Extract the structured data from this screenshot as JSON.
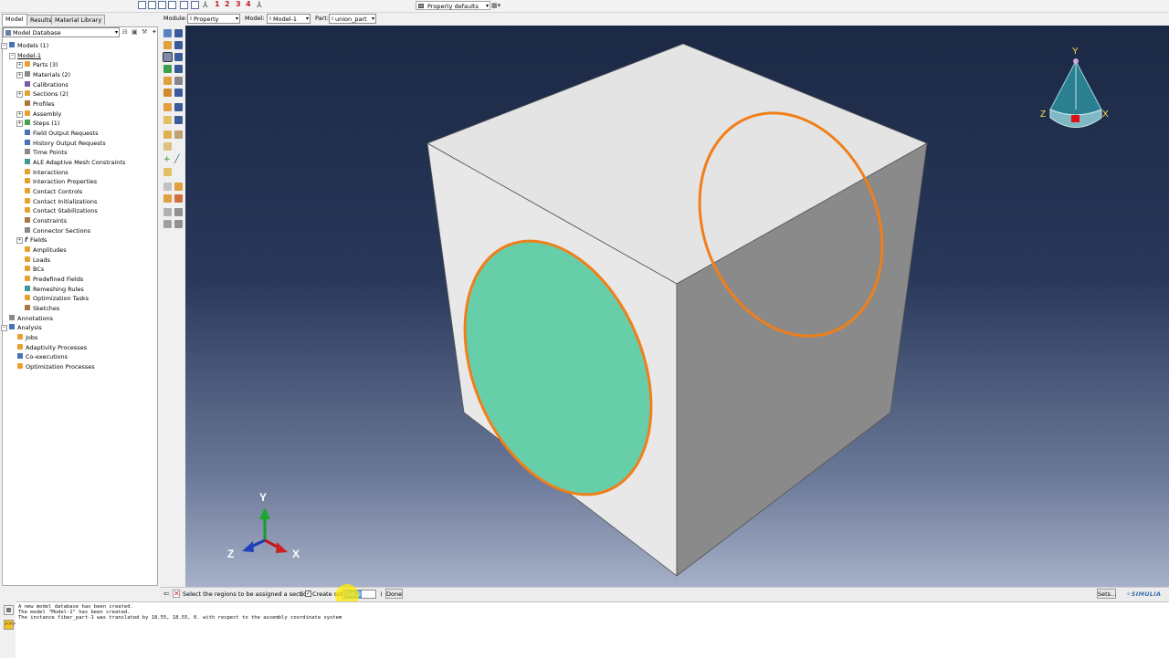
{
  "top_toolbar": {
    "view_numbers": [
      "1",
      "2",
      "3",
      "4"
    ],
    "property_defaults_label": "Property defaults"
  },
  "tabs": [
    {
      "label": "Model",
      "active": true
    },
    {
      "label": "Results",
      "active": false
    },
    {
      "label": "Material Library",
      "active": false
    }
  ],
  "context": {
    "module_label": "Module:",
    "module_value": "Property",
    "model_label": "Model:",
    "model_value": "Model-1",
    "part_label": "Part:",
    "part_value": "union_part"
  },
  "tree": {
    "database_label": "Model Database",
    "nodes": [
      {
        "label": "Models (1)"
      },
      {
        "label": "Model-1"
      },
      {
        "label": "Parts (3)"
      },
      {
        "label": "Materials (2)"
      },
      {
        "label": "Calibrations"
      },
      {
        "label": "Sections (2)"
      },
      {
        "label": "Profiles"
      },
      {
        "label": "Assembly"
      },
      {
        "label": "Steps (1)"
      },
      {
        "label": "Field Output Requests"
      },
      {
        "label": "History Output Requests"
      },
      {
        "label": "Time Points"
      },
      {
        "label": "ALE Adaptive Mesh Constraints"
      },
      {
        "label": "Interactions"
      },
      {
        "label": "Interaction Properties"
      },
      {
        "label": "Contact Controls"
      },
      {
        "label": "Contact Initializations"
      },
      {
        "label": "Contact Stabilizations"
      },
      {
        "label": "Constraints"
      },
      {
        "label": "Connector Sections"
      },
      {
        "label": "Fields"
      },
      {
        "label": "Amplitudes"
      },
      {
        "label": "Loads"
      },
      {
        "label": "BCs"
      },
      {
        "label": "Predefined Fields"
      },
      {
        "label": "Remeshing Rules"
      },
      {
        "label": "Optimization Tasks"
      },
      {
        "label": "Sketches"
      },
      {
        "label": "Annotations"
      },
      {
        "label": "Analysis"
      },
      {
        "label": "Jobs"
      },
      {
        "label": "Adaptivity Processes"
      },
      {
        "label": "Co-executions"
      },
      {
        "label": "Optimization Processes"
      }
    ]
  },
  "viewport": {
    "triad": {
      "x": "X",
      "y": "Y",
      "z": "Z"
    },
    "view_cube": {
      "x": "X",
      "y": "Y",
      "z": "Z"
    },
    "colors": {
      "selected_face": "#66cfaa",
      "edge_highlight": "#f07f1a"
    }
  },
  "prompt": {
    "message": "Select the regions to be assigned a section",
    "open_paren": "(",
    "create_set_label": "Create set:",
    "create_set_checked": true,
    "set_name": "Set-3",
    "close_paren": ")",
    "done_label": "Done",
    "sets_label": "Sets...",
    "brand": "SIMULIA"
  },
  "messages": [
    "A new model database has been created.",
    "The model \"Model-1\" has been created.",
    "The instance fiber_part-1 was translated by 18.55, 18.55, 0. with respect to the assembly coordinate system"
  ]
}
